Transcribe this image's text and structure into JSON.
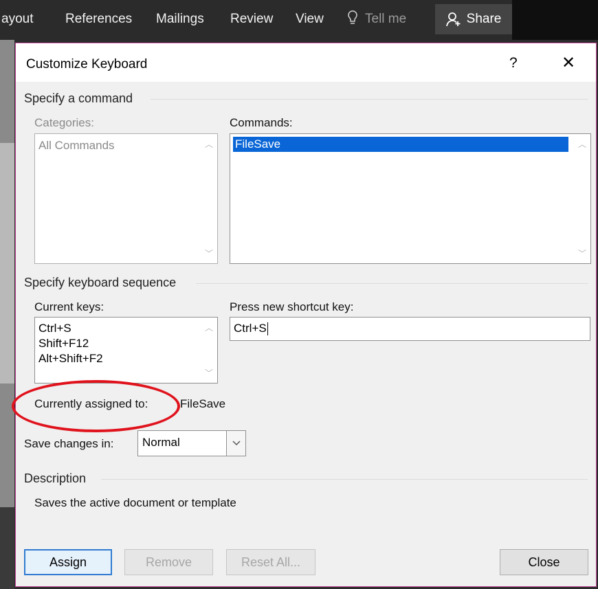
{
  "ribbon": {
    "tabs": [
      "ayout",
      "References",
      "Mailings",
      "Review",
      "View"
    ],
    "tell_me": "Tell me",
    "share": "Share"
  },
  "dialog": {
    "title": "Customize Keyboard",
    "help": "?",
    "close_glyph": "✕",
    "specify_command": {
      "heading": "Specify a command",
      "categories_label": "Categories:",
      "categories": [
        "All Commands"
      ],
      "commands_label": "Commands:",
      "commands": [
        "FileSave"
      ]
    },
    "specify_keys": {
      "heading": "Specify keyboard sequence",
      "current_keys_label": "Current keys:",
      "current_keys": [
        "Ctrl+S",
        "Shift+F12",
        "Alt+Shift+F2"
      ],
      "new_key_label": "Press new shortcut key:",
      "new_key_value": "Ctrl+S"
    },
    "assigned": {
      "label": "Currently assigned to:",
      "value": "FileSave"
    },
    "save_in": {
      "label": "Save changes in:",
      "value": "Normal"
    },
    "description": {
      "heading": "Description",
      "text": "Saves the active document or template"
    },
    "buttons": {
      "assign": "Assign",
      "remove": "Remove",
      "reset_all": "Reset All...",
      "close": "Close"
    }
  },
  "icons": {
    "bulb": "lightbulb-icon",
    "share": "person-add-icon",
    "scroll_up": "chevron-up-icon",
    "scroll_down": "chevron-down-icon"
  },
  "colors": {
    "selection": "#0a66d6",
    "default_button_border": "#2e7bd1",
    "annotation": "#e0131d",
    "dialog_border": "#c8479b"
  }
}
